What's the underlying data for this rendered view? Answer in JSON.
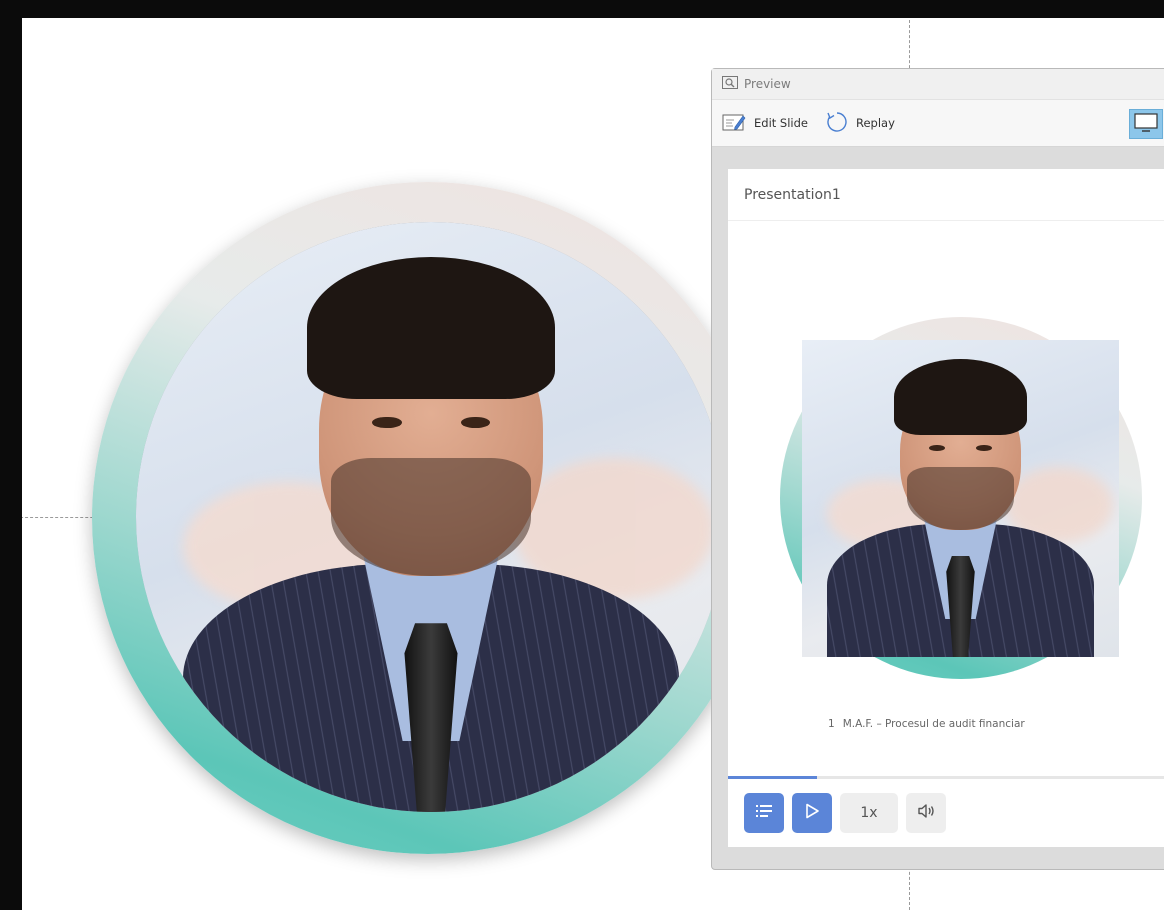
{
  "preview": {
    "window_title": "Preview",
    "toolbar": {
      "edit_slide_label": "Edit Slide",
      "replay_label": "Replay"
    },
    "player": {
      "presentation_title": "Presentation1",
      "slide_caption": {
        "number": "1",
        "title": "M.A.F. – Procesul de audit financiar"
      },
      "progress_fraction": 0.2,
      "speed_label": "1x"
    }
  },
  "colors": {
    "accent": "#5b85d8",
    "ring_teal": "#5cc6b8",
    "monitor_highlight": "#8cc6ea"
  },
  "icons": [
    "preview-icon",
    "edit-slide-icon",
    "replay-icon",
    "monitor-icon",
    "outline-list-icon",
    "play-icon",
    "volume-icon"
  ]
}
